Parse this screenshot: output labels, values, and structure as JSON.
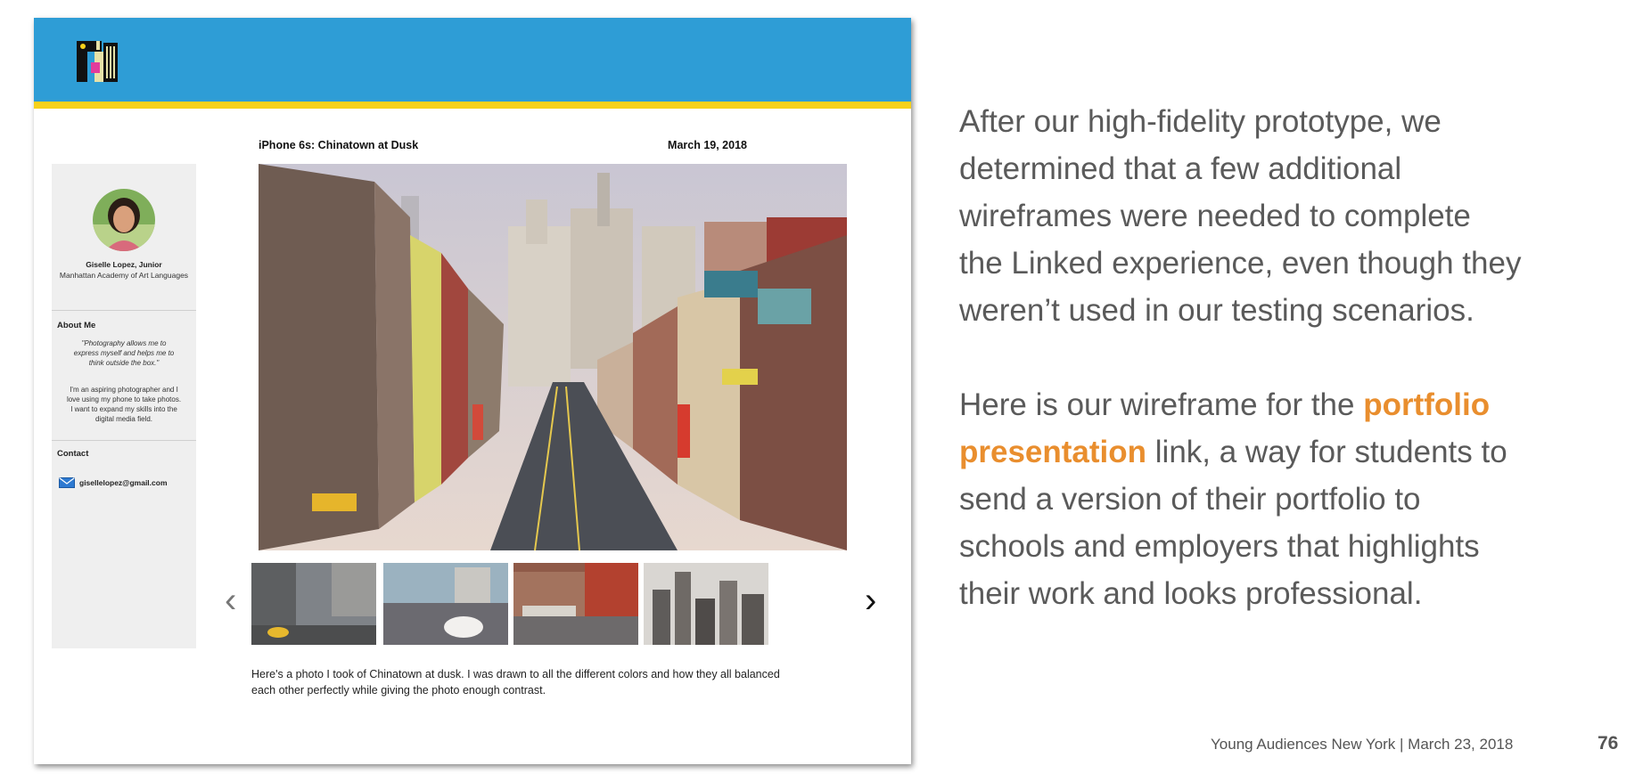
{
  "mockup": {
    "logo_icon": "yany-logo-icon",
    "colors": {
      "header": "#2e9dd6",
      "stripe": "#f7d11b",
      "sidebar": "#efefef"
    },
    "sidebar": {
      "name": "Giselle Lopez, Junior",
      "school": "Manhattan Academy of Art Languages",
      "about_heading": "About Me",
      "quote_lines": [
        "\"Photography allows me to",
        "express myself and helps me to",
        "think outside the box.\""
      ],
      "bio_lines": [
        "I'm an aspiring photographer and I",
        "love using my phone to take photos.",
        "I want to expand my skills into the",
        "digital media field."
      ],
      "contact_heading": "Contact",
      "email_icon": "envelope-icon",
      "email": "gisellelopez@gmail.com"
    },
    "photo": {
      "title": "iPhone 6s: Chinatown at Dusk",
      "date": "March 19, 2018"
    },
    "carousel": {
      "prev_icon": "chevron-left-icon",
      "next_icon": "chevron-right-icon",
      "prev_glyph": "‹",
      "next_glyph": "›"
    },
    "caption_lines": [
      "Here's a photo I took of Chinatown at dusk.  I was drawn to all the different colors and how they all balanced",
      "each other perfectly while giving the photo enough contrast."
    ]
  },
  "description": {
    "paragraph1_lines": [
      "After our high-fidelity prototype, we",
      "determined that a few additional",
      "wireframes were needed to complete",
      "the Linked experience, even though they",
      "weren’t used in our testing scenarios."
    ],
    "p2_line1_pre": "Here is our wireframe for the ",
    "p2_line1_hl": "portfolio",
    "p2_line2_hl": "presentation",
    "p2_line2_post": " link, a way for students to",
    "p2_rest_lines": [
      "send a version of their portfolio to",
      "schools and employers that highlights",
      "their work and looks professional."
    ],
    "highlight_color": "#e98e2e"
  },
  "footer": {
    "org": "Young Audiences New York |  March 23, 2018",
    "page_number": "76"
  }
}
